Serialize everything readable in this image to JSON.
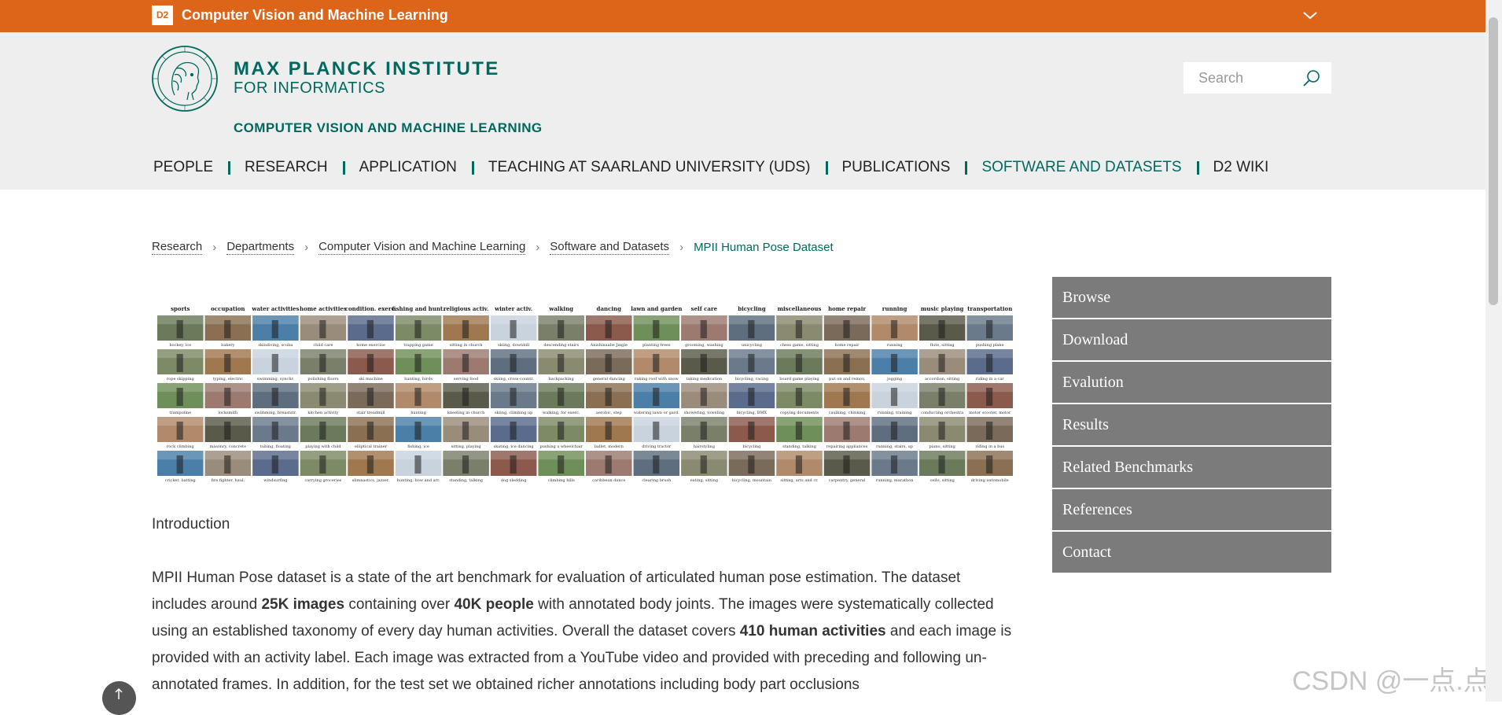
{
  "topbar": {
    "badge": "D2",
    "title": "Computer Vision and Machine Learning",
    "toggle_icon": "chevron-down-icon",
    "color": "#dd6519"
  },
  "header": {
    "institute_line1": "MAX PLANCK INSTITUTE",
    "institute_line2": "FOR INFORMATICS",
    "department": "COMPUTER VISION AND MACHINE LEARNING",
    "accent_color": "#00695f",
    "logo_icon": "minerva-logo-icon"
  },
  "search": {
    "placeholder": "Search",
    "icon": "search-icon"
  },
  "nav": {
    "items": [
      {
        "label": "PEOPLE"
      },
      {
        "label": "RESEARCH"
      },
      {
        "label": "APPLICATION"
      },
      {
        "label": "TEACHING AT SAARLAND UNIVERSITY (UDS)"
      },
      {
        "label": "PUBLICATIONS"
      },
      {
        "label": "SOFTWARE AND DATASETS"
      },
      {
        "label": "D2 WIKI"
      }
    ],
    "active_index": 5
  },
  "breadcrumb": {
    "items": [
      "Research",
      "Departments",
      "Computer Vision and Machine Learning",
      "Software and Datasets"
    ],
    "current": "MPII Human Pose Dataset"
  },
  "mosaic": {
    "headers": [
      "sports",
      "occupation",
      "water activities",
      "home activities",
      "condition. exerc.",
      "fishing and hunt.",
      "religious activ.",
      "winter activ.",
      "walking",
      "dancing",
      "lawn and garden",
      "self care",
      "bicycling",
      "miscellaneous",
      "home repair",
      "running",
      "music playing",
      "transportation"
    ],
    "captions": [
      [
        "hockey, ice",
        "bakery",
        "skindiving, scuba",
        "child care",
        "home exercise",
        "trapping game",
        "sitting in church",
        "skiing, downhill",
        "descending stairs",
        "Anishinaabe Jingle",
        "planting trees",
        "grooming, washing",
        "unicycling",
        "chess game, sitting",
        "home repair",
        "running",
        "flute, sitting",
        "pushing plane"
      ],
      [
        "rope skipping",
        "typing, electric",
        "swimming, synchr.",
        "polishing floors",
        "ski machine",
        "hunting, birds",
        "serving food",
        "skiing, cross-countr.",
        "backpacking",
        "general dancing",
        "raking roof with snow",
        "taking medication",
        "bicycling, racing",
        "board game playing",
        "put on and remov.",
        "jogging",
        "accordion, sitting",
        "riding in a car"
      ],
      [
        "trampoline",
        "locksmith",
        "swimming, breaststr.",
        "kitchen activity",
        "stair treadmill",
        "hunting",
        "kneeling in church",
        "skiing, climbing up",
        "walking, for exerc.",
        "aerobic, step",
        "watering lawn or gard.",
        "showering, toweling",
        "bicycling, BMX",
        "copying documents",
        "caulking, chinking",
        "running, training",
        "conducting orchestra",
        "motor scooter, motor"
      ],
      [
        "rock climbing",
        "masonry, concrete",
        "tubing, floating",
        "playing with child",
        "elliptical trainer",
        "fishing, ice",
        "sitting, playing",
        "skating, ice dancing",
        "pushing a wheelchair",
        "ballet, modern",
        "driving tractor",
        "hairstyling",
        "bicycling",
        "standing, talking",
        "repairing appliances",
        "running, stairs, up",
        "piano, sitting",
        "riding in a bus"
      ],
      [
        "cricket, batting",
        "fire fighter, haul.",
        "windsurfing",
        "carrying groceries",
        "slimnastics, jazzer.",
        "hunting, bow and arr.",
        "standing, talking",
        "dog sledding",
        "climbing hills",
        "caribbean dance",
        "clearing brush",
        "eating, sitting",
        "bicycling, mountain",
        "sitting, arts and cr.",
        "carpentry, general",
        "running, marathon",
        "cello, sitting",
        "driving automobile"
      ]
    ]
  },
  "content": {
    "intro_heading": "Introduction",
    "para": {
      "s1": "MPII Human Pose dataset is a state of the art benchmark for evaluation of articulated human pose estimation. The dataset includes around ",
      "b1": "25K images",
      "s2": " containing over ",
      "b2": "40K people",
      "s3": " with annotated body joints. The images were systematically collected using an established taxonomy of every day human activities. Overall the dataset covers ",
      "b3": "410 human activities",
      "s4": " and each image is provided with an activity label. Each image was extracted from a YouTube video and provided with preceding and following un-annotated frames. In addition, for the test set we obtained richer annotations including body part occlusions"
    }
  },
  "sidebar": {
    "items": [
      {
        "label": "Browse"
      },
      {
        "label": "Download"
      },
      {
        "label": "Evalution"
      },
      {
        "label": "Results"
      },
      {
        "label": "Related Benchmarks"
      },
      {
        "label": "References"
      },
      {
        "label": "Contact"
      }
    ],
    "color": "#7b7b7b"
  },
  "back_to_top_icon": "arrow-up-icon",
  "watermark": "CSDN @一点.点"
}
